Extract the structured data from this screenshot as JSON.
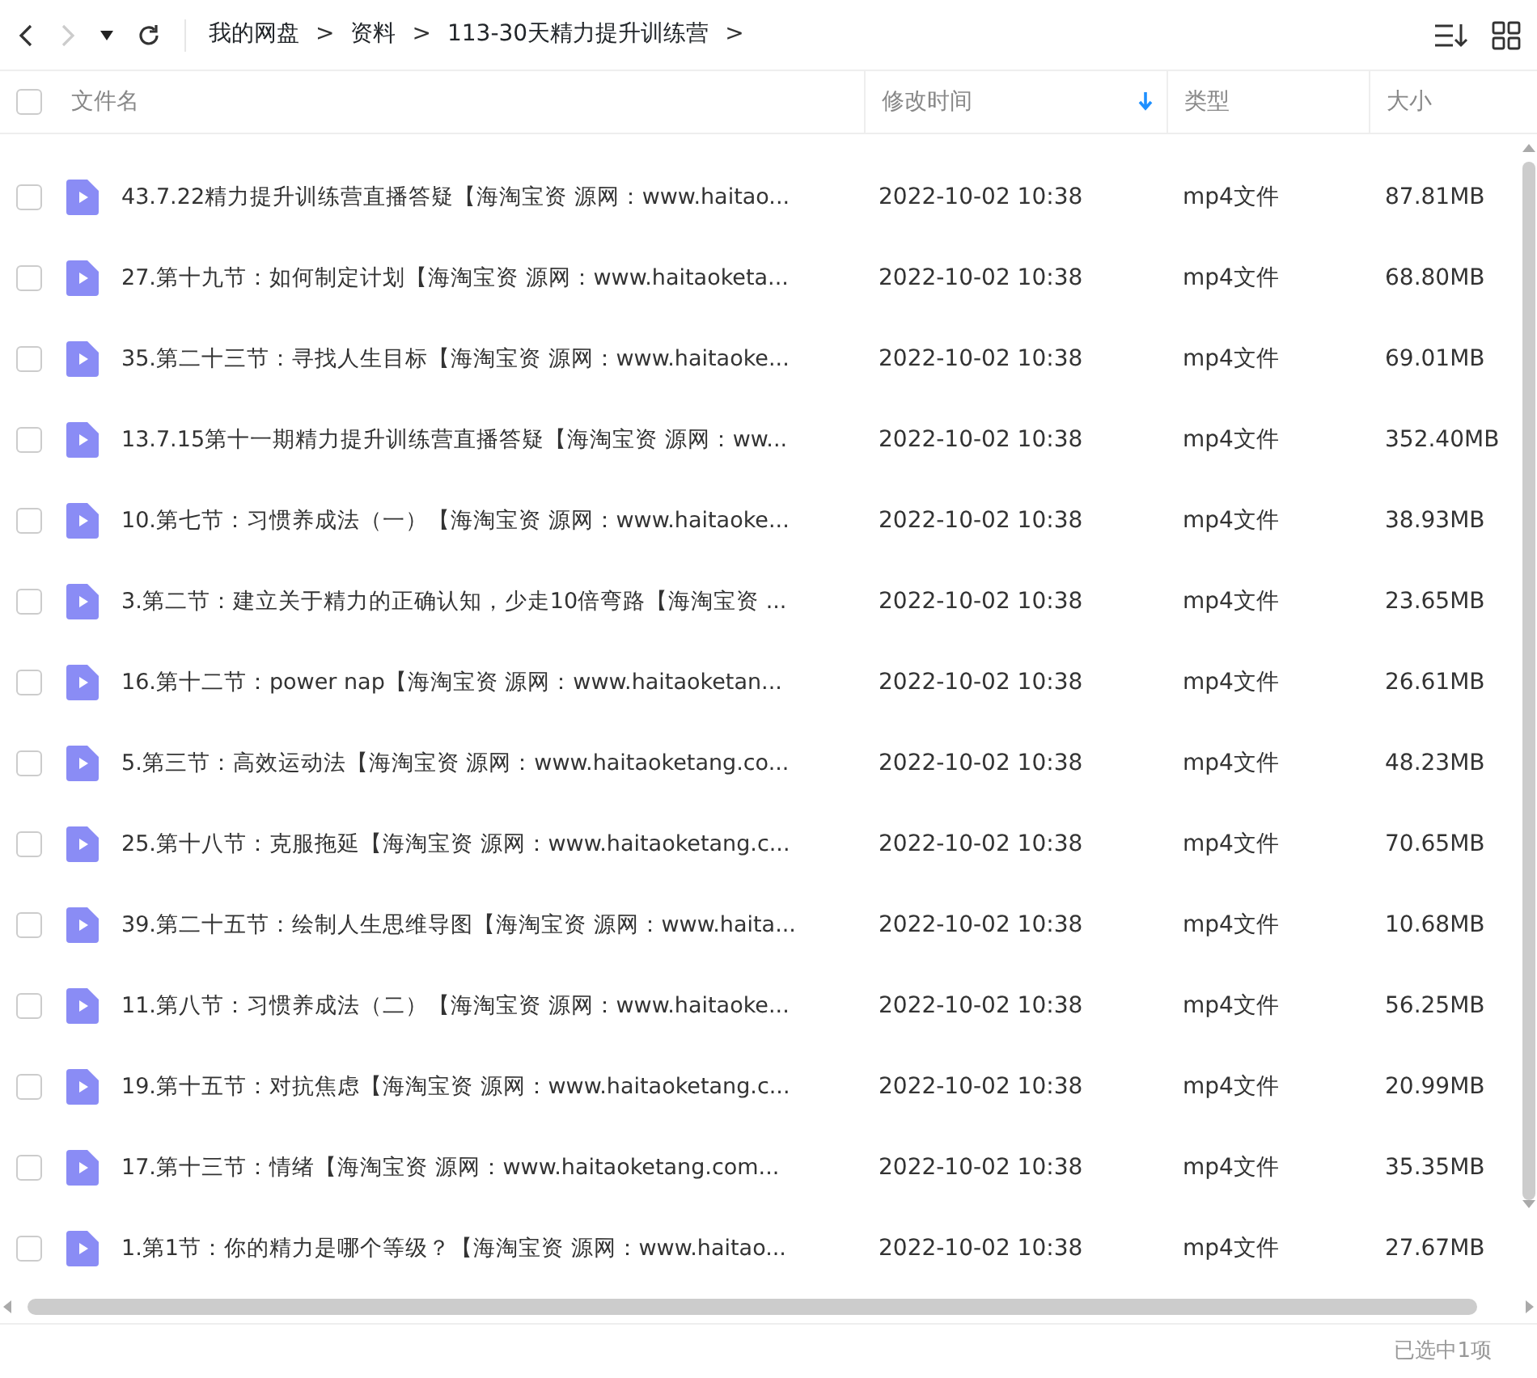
{
  "toolbar": {
    "breadcrumbs": [
      {
        "label": "我的网盘"
      },
      {
        "label": "资料"
      },
      {
        "label": "113-30天精力提升训练营"
      }
    ],
    "separator": ">",
    "back_disabled": false,
    "forward_disabled": true
  },
  "table": {
    "select_all": {
      "checked": false
    },
    "columns": [
      {
        "label": "文件名",
        "sorted": false
      },
      {
        "label": "修改时间",
        "sorted": true
      },
      {
        "label": "类型",
        "sorted": false
      },
      {
        "label": "大小",
        "sorted": false
      }
    ],
    "rows": [
      {
        "name": "43.7.22精力提升训练营直播答疑【海淘宝资 源网：www.haitao...",
        "modified": "2022-10-02 10:38",
        "type": "mp4文件",
        "size": "87.81MB",
        "checked": false
      },
      {
        "name": "27.第十九节：如何制定计划【海淘宝资 源网：www.haitaoketa...",
        "modified": "2022-10-02 10:38",
        "type": "mp4文件",
        "size": "68.80MB",
        "checked": false
      },
      {
        "name": "35.第二十三节：寻找人生目标【海淘宝资 源网：www.haitaoke...",
        "modified": "2022-10-02 10:38",
        "type": "mp4文件",
        "size": "69.01MB",
        "checked": false
      },
      {
        "name": "13.7.15第十一期精力提升训练营直播答疑【海淘宝资 源网：ww...",
        "modified": "2022-10-02 10:38",
        "type": "mp4文件",
        "size": "352.40MB",
        "checked": false
      },
      {
        "name": "10.第七节：习惯养成法（一）【海淘宝资 源网：www.haitaoke...",
        "modified": "2022-10-02 10:38",
        "type": "mp4文件",
        "size": "38.93MB",
        "checked": false
      },
      {
        "name": "3.第二节：建立关于精力的正确认知，少走10倍弯路【海淘宝资 ...",
        "modified": "2022-10-02 10:38",
        "type": "mp4文件",
        "size": "23.65MB",
        "checked": false
      },
      {
        "name": "16.第十二节：power nap【海淘宝资 源网：www.haitaoketan...",
        "modified": "2022-10-02 10:38",
        "type": "mp4文件",
        "size": "26.61MB",
        "checked": false
      },
      {
        "name": "5.第三节：高效运动法【海淘宝资 源网：www.haitaoketang.co...",
        "modified": "2022-10-02 10:38",
        "type": "mp4文件",
        "size": "48.23MB",
        "checked": false
      },
      {
        "name": "25.第十八节：克服拖延【海淘宝资 源网：www.haitaoketang.c...",
        "modified": "2022-10-02 10:38",
        "type": "mp4文件",
        "size": "70.65MB",
        "checked": false
      },
      {
        "name": "39.第二十五节：绘制人生思维导图【海淘宝资 源网：www.haita...",
        "modified": "2022-10-02 10:38",
        "type": "mp4文件",
        "size": "10.68MB",
        "checked": false
      },
      {
        "name": "11.第八节：习惯养成法（二）【海淘宝资 源网：www.haitaoke...",
        "modified": "2022-10-02 10:38",
        "type": "mp4文件",
        "size": "56.25MB",
        "checked": false
      },
      {
        "name": "19.第十五节：对抗焦虑【海淘宝资 源网：www.haitaoketang.c...",
        "modified": "2022-10-02 10:38",
        "type": "mp4文件",
        "size": "20.99MB",
        "checked": false
      },
      {
        "name": "17.第十三节：情绪【海淘宝资 源网：www.haitaoketang.com...",
        "modified": "2022-10-02 10:38",
        "type": "mp4文件",
        "size": "35.35MB",
        "checked": false
      },
      {
        "name": "1.第1节：你的精力是哪个等级？【海淘宝资 源网：www.haitao...",
        "modified": "2022-10-02 10:38",
        "type": "mp4文件",
        "size": "27.67MB",
        "checked": false
      }
    ]
  },
  "status_bar": {
    "text": "已选中1项"
  }
}
